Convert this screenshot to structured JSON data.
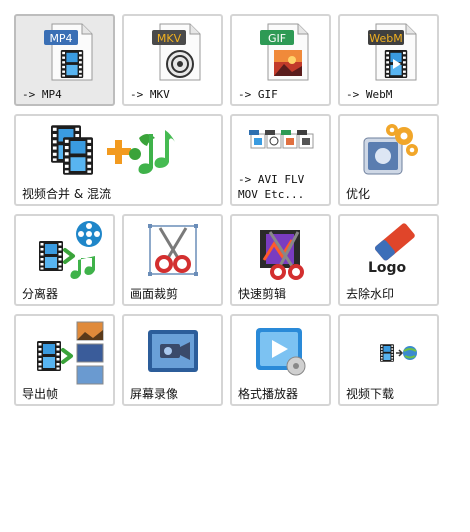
{
  "tiles": [
    {
      "id": "mp4",
      "label": "-> MP4",
      "badge": "MP4",
      "badge_color": "#3a6fb5"
    },
    {
      "id": "mkv",
      "label": "-> MKV",
      "badge": "MKV",
      "badge_color": "#4a4a4a"
    },
    {
      "id": "gif",
      "label": "-> GIF",
      "badge": "GIF",
      "badge_color": "#2e9a55"
    },
    {
      "id": "webm",
      "label": "-> WebM",
      "badge": "WebM",
      "badge_color": "#3f3f3f"
    },
    {
      "id": "merge",
      "label": "视频合并 & 混流"
    },
    {
      "id": "avi",
      "label": "-> AVI FLV\nMOV Etc..."
    },
    {
      "id": "optimize",
      "label": "优化"
    },
    {
      "id": "splitter",
      "label": "分离器"
    },
    {
      "id": "crop",
      "label": "画面裁剪"
    },
    {
      "id": "quickcut",
      "label": "快速剪辑"
    },
    {
      "id": "delogo",
      "label": "去除水印",
      "logo_text": "Logo"
    },
    {
      "id": "frames",
      "label": "导出帧"
    },
    {
      "id": "screenrec",
      "label": "屏幕录像"
    },
    {
      "id": "player",
      "label": "格式播放器"
    },
    {
      "id": "download",
      "label": "视频下载"
    }
  ]
}
